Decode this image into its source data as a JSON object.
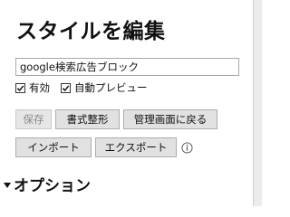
{
  "editor": {
    "title": "スタイルを編集",
    "name_value": "google検索広告ブロック",
    "enabled": {
      "label": "有効",
      "checked": true
    },
    "live_preview": {
      "label": "自動プレビュー",
      "checked": true
    },
    "buttons": {
      "save": "保存",
      "beautify": "書式整形",
      "back_to_manage": "管理画面に戻る",
      "import": "インポート",
      "export": "エクスポート"
    },
    "info_icon": "info-icon",
    "options_section": {
      "label": "オプション",
      "expanded": true
    }
  }
}
